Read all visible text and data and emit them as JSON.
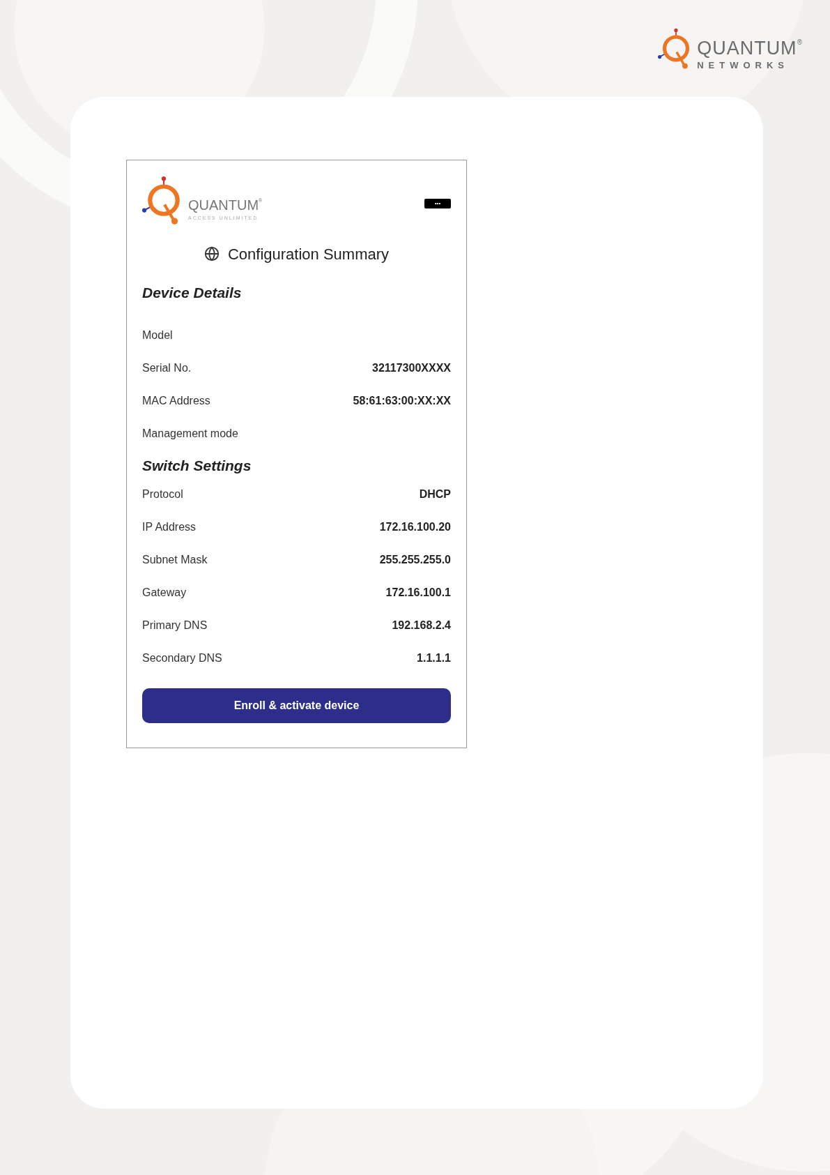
{
  "brand": {
    "name": "QUANTUM",
    "mark": "®",
    "tagline": "NETWORKS"
  },
  "app": {
    "logo": {
      "name": "QUANTUM",
      "mark": "®",
      "tagline": "ACCESS UNLIMITED"
    },
    "menu_label": "•••",
    "title": "Configuration Summary",
    "sections": [
      {
        "heading": "Device Details",
        "rows": [
          {
            "label": "Model"
          },
          {
            "label": "Serial No.",
            "value": "32117300XXXX"
          },
          {
            "label": "MAC Address",
            "value": "58:61:63:00:XX:XX"
          },
          {
            "label": "Management mode"
          }
        ]
      },
      {
        "heading": "Switch Settings",
        "rows": [
          {
            "label": "Protocol",
            "value": "DHCP"
          },
          {
            "label": "IP Address",
            "value": "172.16.100.20"
          },
          {
            "label": "Subnet Mask",
            "value": "255.255.255.0"
          },
          {
            "label": "Gateway",
            "value": "172.16.100.1"
          },
          {
            "label": "Primary DNS",
            "value": "192.168.2.4"
          },
          {
            "label": "Secondary DNS",
            "value": "1.1.1.1"
          }
        ]
      }
    ],
    "button": "Enroll & activate device"
  }
}
